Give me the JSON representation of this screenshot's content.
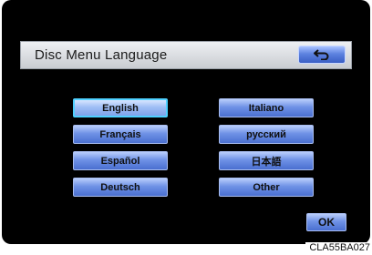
{
  "header": {
    "title": "Disc Menu Language",
    "back_icon": "return-arrow-icon"
  },
  "languages": {
    "left": [
      "English",
      "Français",
      "Español",
      "Deutsch"
    ],
    "right": [
      "Italiano",
      "русский",
      "日本語",
      "Other"
    ],
    "selected": "English"
  },
  "footer": {
    "ok_label": "OK"
  },
  "figure_code": "CLA55BA027",
  "colors": {
    "button_blue": "#6f92e6",
    "selected_outline": "#4fd0ff",
    "background": "#000000"
  }
}
